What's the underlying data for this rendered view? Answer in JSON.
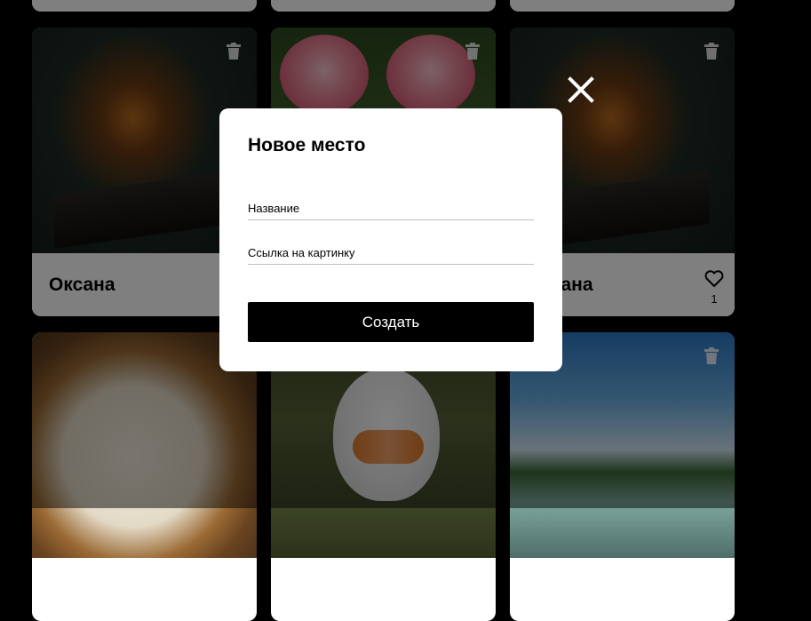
{
  "cards": [
    {
      "title": "Оксана",
      "likes": "",
      "image": "campfire",
      "has_trash": true
    },
    {
      "title": "",
      "likes": "",
      "image": "pink roses",
      "has_trash": true
    },
    {
      "title": "Оксана",
      "likes": "1",
      "image": "campfire",
      "has_trash": true
    },
    {
      "title": "",
      "likes": "",
      "image": "salad bowl",
      "has_trash": false
    },
    {
      "title": "",
      "likes": "",
      "image": "white bird",
      "has_trash": false
    },
    {
      "title": "",
      "likes": "",
      "image": "river landscape",
      "has_trash": true
    }
  ],
  "popup": {
    "title": "Новое место",
    "name_placeholder": "Название",
    "link_placeholder": "Ссылка на картинку",
    "submit_label": "Создать"
  },
  "icons": {
    "close": "close-icon",
    "trash": "trash-icon",
    "like": "heart-icon"
  },
  "colors": {
    "page_background": "#000000",
    "popup_background": "#ffffff",
    "button_background": "#000000",
    "overlay": "rgba(0,0,0,0.5)"
  }
}
